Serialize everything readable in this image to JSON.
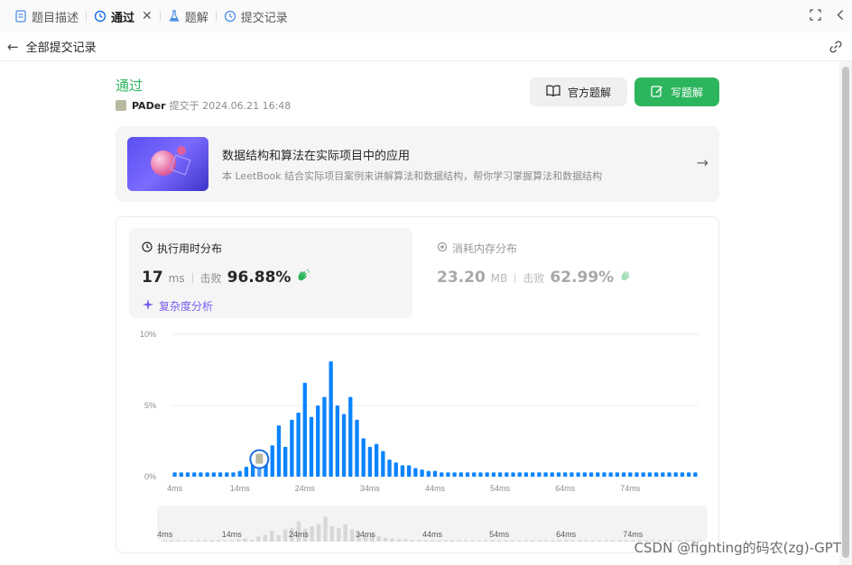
{
  "tabs": [
    {
      "label": "题目描述",
      "icon": "document-icon",
      "active": false
    },
    {
      "label": "通过",
      "icon": "history-icon",
      "active": true
    },
    {
      "label": "题解",
      "icon": "flask-icon",
      "active": false
    },
    {
      "label": "提交记录",
      "icon": "history-icon",
      "active": false
    }
  ],
  "subbar": {
    "title": "全部提交记录"
  },
  "submission": {
    "status": "通过",
    "author": "PADer",
    "submitted_text": "提交于 2024.06.21 16:48"
  },
  "buttons": {
    "official": "官方题解",
    "write": "写题解"
  },
  "banner": {
    "title": "数据结构和算法在实际项目中的应用",
    "desc": "本 LeetBook 结合实际项目案例来讲解算法和数据结构，帮你学习掌握算法和数据结构"
  },
  "runtime": {
    "header": "执行用时分布",
    "value": "17",
    "unit": "ms",
    "beats_label": "击败",
    "beats": "96.88%",
    "complexity_link": "复杂度分析"
  },
  "memory": {
    "header": "消耗内存分布",
    "value": "23.20",
    "unit": "MB",
    "beats_label": "击败",
    "beats": "62.99%"
  },
  "watermark": "CSDN @fighting的码农(zg)-GPT",
  "colors": {
    "accent_green": "#2db55d",
    "bar_blue": "#0a84ff",
    "purple": "#7a5cf0"
  },
  "chart_data": {
    "type": "bar",
    "y_tick_labels": [
      "10%",
      "5%",
      "0%"
    ],
    "ylim": [
      0,
      10
    ],
    "x_tick_labels": [
      "4ms",
      "14ms",
      "24ms",
      "34ms",
      "44ms",
      "54ms",
      "64ms",
      "74ms"
    ],
    "x_start": 4,
    "x_step": 1,
    "values": [
      0.3,
      0.3,
      0.3,
      0.3,
      0.3,
      0.3,
      0.3,
      0.3,
      0.3,
      0.3,
      0.4,
      0.7,
      1.0,
      0.6,
      1.7,
      2.2,
      3.6,
      2.1,
      4.0,
      4.5,
      6.6,
      4.2,
      5.0,
      5.6,
      8.1,
      5.0,
      4.4,
      5.6,
      4.0,
      2.7,
      2.1,
      2.3,
      1.8,
      1.2,
      1.0,
      0.8,
      0.8,
      0.6,
      0.5,
      0.4,
      0.4,
      0.3,
      0.3,
      0.3,
      0.3,
      0.3,
      0.3,
      0.3,
      0.3,
      0.3,
      0.3,
      0.3,
      0.3,
      0.3,
      0.3,
      0.3,
      0.3,
      0.3,
      0.3,
      0.3,
      0.3,
      0.3,
      0.3,
      0.3,
      0.3,
      0.3,
      0.3,
      0.3,
      0.3,
      0.3,
      0.3,
      0.3,
      0.3,
      0.3,
      0.3,
      0.3,
      0.3,
      0.3,
      0.3,
      0.3,
      0.3
    ],
    "highlighted_x": 17
  }
}
